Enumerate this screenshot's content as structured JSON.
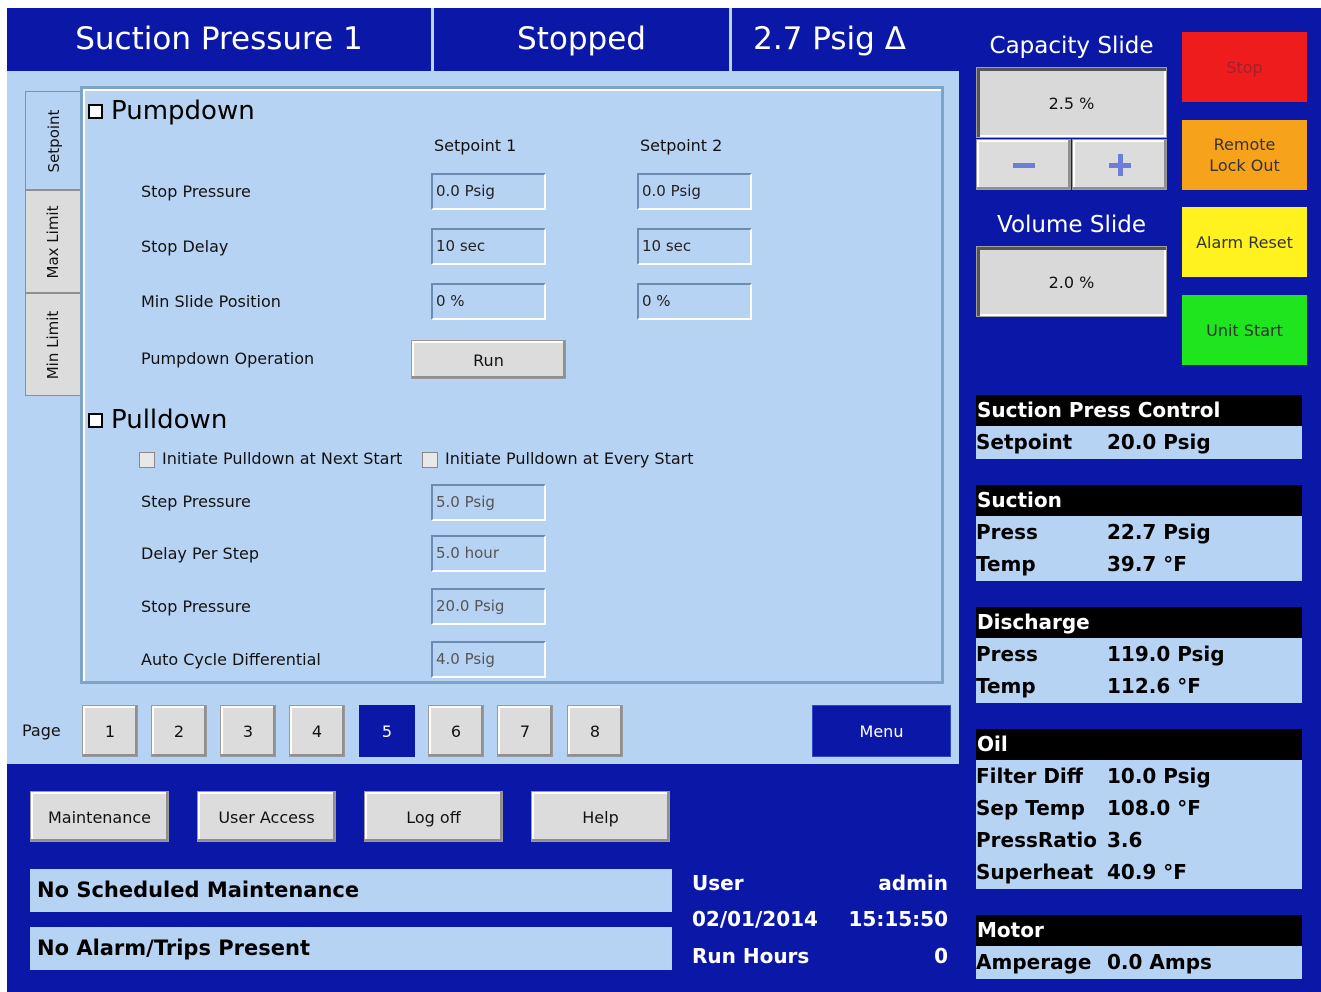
{
  "header": {
    "title": "Suction Pressure 1",
    "status": "Stopped",
    "delta": "2.7 Psig Δ"
  },
  "tabs": [
    "Setpoint",
    "Max Limit",
    "Min Limit"
  ],
  "pumpdown": {
    "heading": "Pumpdown",
    "col1": "Setpoint 1",
    "col2": "Setpoint 2",
    "rows": [
      {
        "label": "Stop Pressure",
        "sp1": "0.0 Psig",
        "sp2": "0.0 Psig"
      },
      {
        "label": "Stop Delay",
        "sp1": "10 sec",
        "sp2": "10 sec"
      },
      {
        "label": "Min Slide Position",
        "sp1": "0 %",
        "sp2": "0 %"
      }
    ],
    "operation_label": "Pumpdown Operation",
    "run_label": "Run"
  },
  "pulldown": {
    "heading": "Pulldown",
    "check_next": "Initiate Pulldown at Next Start",
    "check_every": "Initiate Pulldown at Every Start",
    "rows": [
      {
        "label": "Step Pressure",
        "value": "5.0 Psig"
      },
      {
        "label": "Delay Per Step",
        "value": "5.0 hour"
      },
      {
        "label": "Stop Pressure",
        "value": "20.0 Psig"
      },
      {
        "label": "Auto Cycle Differential",
        "value": "4.0 Psig"
      }
    ]
  },
  "pager": {
    "label": "Page",
    "pages": [
      "1",
      "2",
      "3",
      "4",
      "5",
      "6",
      "7",
      "8"
    ],
    "active_index": 4,
    "menu_label": "Menu"
  },
  "footer": {
    "buttons": [
      "Maintenance",
      "User Access",
      "Log off",
      "Help"
    ],
    "maintenance_msg": "No Scheduled Maintenance",
    "alarm_msg": "No Alarm/Trips Present",
    "user_label": "User",
    "user_value": "admin",
    "date": "02/01/2014",
    "time": "15:15:50",
    "run_hours_label": "Run Hours",
    "run_hours_value": "0"
  },
  "capacity": {
    "label": "Capacity Slide",
    "value": "2.5 %",
    "minus_icon": "minus-icon",
    "plus_icon": "plus-icon"
  },
  "volume": {
    "label": "Volume Slide",
    "value": "2.0 %"
  },
  "actions": {
    "stop": {
      "label": "Stop",
      "color": "#ee1c1c"
    },
    "remote": {
      "label": "Remote Lock Out",
      "color": "#f7a21b"
    },
    "alarm": {
      "label": "Alarm Reset",
      "color": "#fff21e"
    },
    "start": {
      "label": "Unit Start",
      "color": "#1ee51e"
    }
  },
  "status_panels": {
    "control": {
      "title": "Suction Press Control",
      "rows": [
        {
          "k": "Setpoint",
          "v": "20.0 Psig"
        }
      ]
    },
    "suction": {
      "title": "Suction",
      "rows": [
        {
          "k": "Press",
          "v": "22.7 Psig"
        },
        {
          "k": "Temp",
          "v": "39.7 °F"
        }
      ]
    },
    "discharge": {
      "title": "Discharge",
      "rows": [
        {
          "k": "Press",
          "v": "119.0 Psig"
        },
        {
          "k": "Temp",
          "v": "112.6 °F"
        }
      ]
    },
    "oil": {
      "title": "Oil",
      "rows": [
        {
          "k": "Filter Diff",
          "v": "10.0 Psig"
        },
        {
          "k": "Sep Temp",
          "v": "108.0 °F"
        },
        {
          "k": "PressRatio",
          "v": "3.6"
        },
        {
          "k": "Superheat",
          "v": "40.9 °F"
        }
      ]
    },
    "motor": {
      "title": "Motor",
      "rows": [
        {
          "k": "Amperage",
          "v": "0.0 Amps"
        }
      ]
    }
  },
  "colors": {
    "frame": "#0b17a7",
    "panel": "#b7d3f3"
  }
}
